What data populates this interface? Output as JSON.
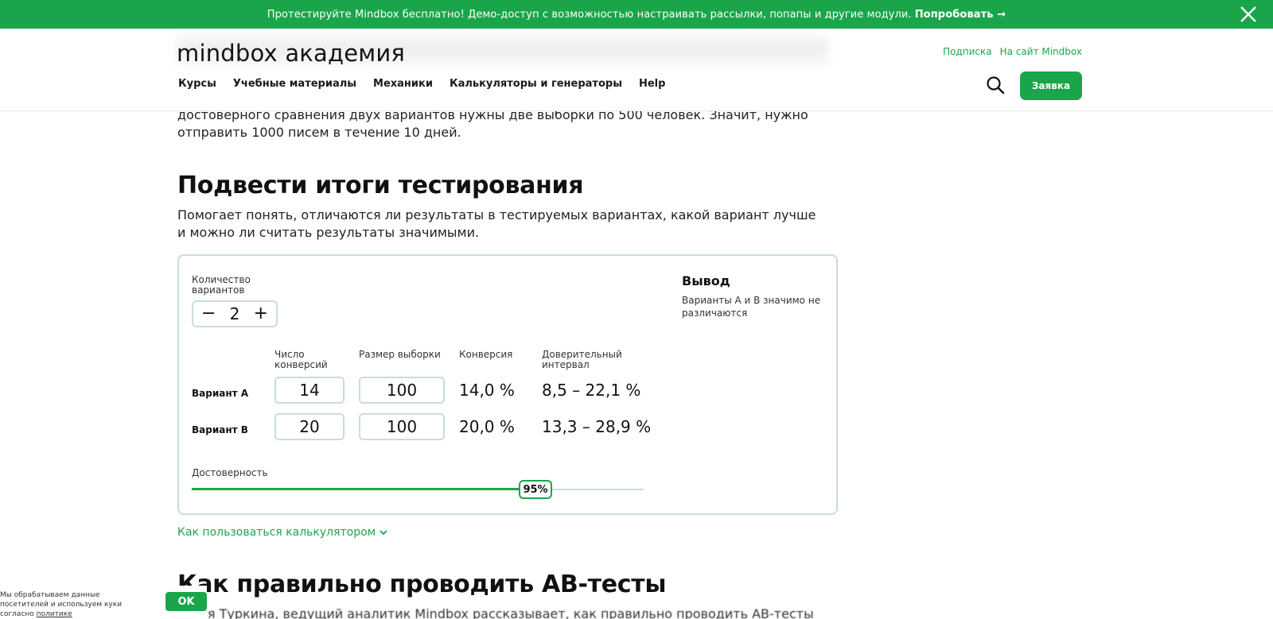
{
  "promo": {
    "text": "Протестируйте Mindbox бесплатно! Демо-доступ с возможностью настраивать рассылки, попапы и другие модули.",
    "link": "Попробовать →",
    "close_icon": "close-icon"
  },
  "header": {
    "logo": "mindbox академия",
    "top_links": [
      "Подписка",
      "На сайт Mindbox"
    ],
    "nav": [
      "Курсы",
      "Учебные материалы",
      "Механики",
      "Калькуляторы и генераторы",
      "Help"
    ],
    "search_icon": "search-icon",
    "request_button": "Заявка"
  },
  "content": {
    "intro_line1": "достоверного сравнения двух вариантов нужны две выборки по 500 человек. Значит, нужно",
    "intro_line2": "отправить 1000 писем в течение 10 дней.",
    "section_title": "Подвести итоги тестирования",
    "section_desc_line1": "Помогает понять, отличаются ли результаты в тестируемых вариантах, какой вариант лучше",
    "section_desc_line2": "и можно ли считать результаты значимыми.",
    "calculator": {
      "variants_label_line1": "Количество",
      "variants_label_line2": "вариантов",
      "variants_count": "2",
      "minus": "−",
      "plus": "+",
      "columns": {
        "conversions_line1": "Число",
        "conversions_line2": "конверсий",
        "sample_size": "Размер выборки",
        "conversion": "Конверсия",
        "interval_line1": "Доверительный",
        "interval_line2": "интервал"
      },
      "rows": [
        {
          "label": "Вариант А",
          "conversions": "14",
          "sample": "100",
          "conversion": "14,0 %",
          "interval": "8,5 – 22,1 %"
        },
        {
          "label": "Вариант В",
          "conversions": "20",
          "sample": "100",
          "conversion": "20,0 %",
          "interval": "13,3 – 28,9 %"
        }
      ],
      "reliability_label": "Достоверность",
      "reliability_value": "95%",
      "reliability_fraction": 0.76,
      "output_title": "Вывод",
      "output_text": "Варианты А и В значимо не различаются"
    },
    "howto_link": "Как пользоваться калькулятором",
    "ab_title": "Как правильно проводить АВ-тесты",
    "ab_text": "Юлия Туркина, ведущий аналитик Mindbox рассказывает, как правильно проводить АВ-тесты"
  },
  "cookie": {
    "text": "Мы обрабатываем данные посетителей и используем куки согласно",
    "link": "политике",
    "ok": "OK"
  },
  "colors": {
    "accent": "#1aa54a",
    "border": "#c9ded3"
  }
}
